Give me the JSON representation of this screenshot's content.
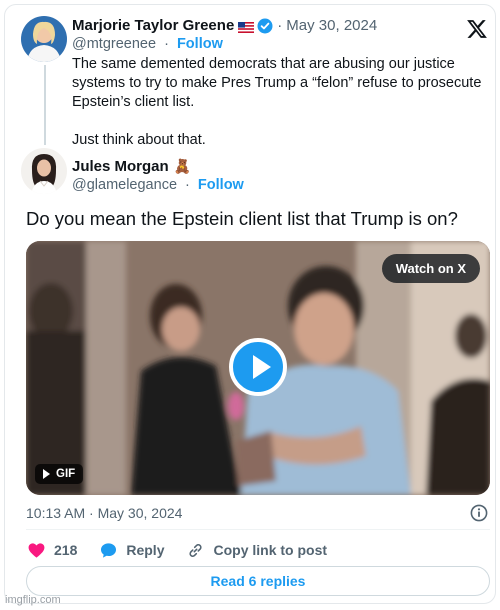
{
  "quoted_tweet": {
    "author_name": "Marjorie Taylor Greene",
    "flag_emoji": "us-flag-icon",
    "verified": true,
    "date": "May 30, 2024",
    "handle": "@mtgreenee",
    "follow_label": "Follow",
    "text_lines": [
      "The same demented democrats that are abusing our justice systems to try to make Pres Trump a “felon” refuse to prosecute Epstein’s client list.",
      "Just think about that."
    ]
  },
  "reply_tweet": {
    "author_name": "Jules Morgan",
    "name_emoji": "🧸",
    "handle": "@glamelegance",
    "follow_label": "Follow",
    "text": "Do you mean the Epstein client list that Trump is on?",
    "media": {
      "watch_label": "Watch on X",
      "gif_label": "GIF"
    },
    "timestamp": "10:13 AM · May 30, 2024",
    "actions": {
      "like_count": "218",
      "reply_label": "Reply",
      "copy_link_label": "Copy link to post"
    },
    "read_replies_label": "Read 6 replies"
  },
  "separator": "·",
  "watermark": "imgflip.com",
  "colors": {
    "accent": "#1d9bf0",
    "like": "#f91880",
    "text_secondary": "#536471"
  }
}
